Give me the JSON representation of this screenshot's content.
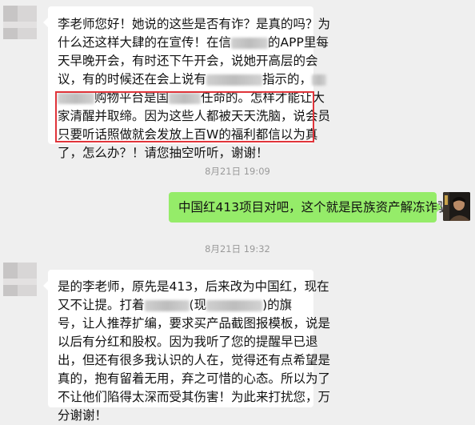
{
  "messages": {
    "m1_lines": [
      "李老师您好！她说的这些是否有诈？是真的吗？为",
      "什么还这样大肆的在宣传！在信",
      "的APP里每",
      "天早晚开会，有时还下午开会，说她开高层的会",
      "议，有的时候还在会上说有",
      "指示的，",
      "购物平台是国",
      "任命的。怎样才能让大",
      "家清醒并取缔。因为这些人都被天天洗脑，说会员",
      "只要听话照做就会发放上百W的福利都信以为真",
      "了，怎么办？！请您抽空听听，谢谢！"
    ],
    "time1": "8月21日 19:09",
    "m2": "中国红413项目对吧，这个就是民族资产解冻诈骗",
    "time2": "8月21日 19:32",
    "m3_lines": [
      "是的李老师，原先是413，后来改为中国红，现在",
      "又不让提。打着",
      "(现",
      ")的旗",
      "号，让人推荐扩编，要求买产品截图报模板，说是",
      "以后有分红和股权。因为我听了您的提醒早已退",
      "出，但还有很多我认识的人在，觉得还有点希望是",
      "真的，抱有留着无用，弃之可惜的心态。所以为了",
      "不让他们陷得太深而受其伤害！为此来打扰您，万",
      "分谢谢！"
    ]
  },
  "colors": {
    "background": "#efefef",
    "bubble_in": "#ffffff",
    "bubble_out": "#95ec69",
    "highlight": "#e0343a"
  }
}
